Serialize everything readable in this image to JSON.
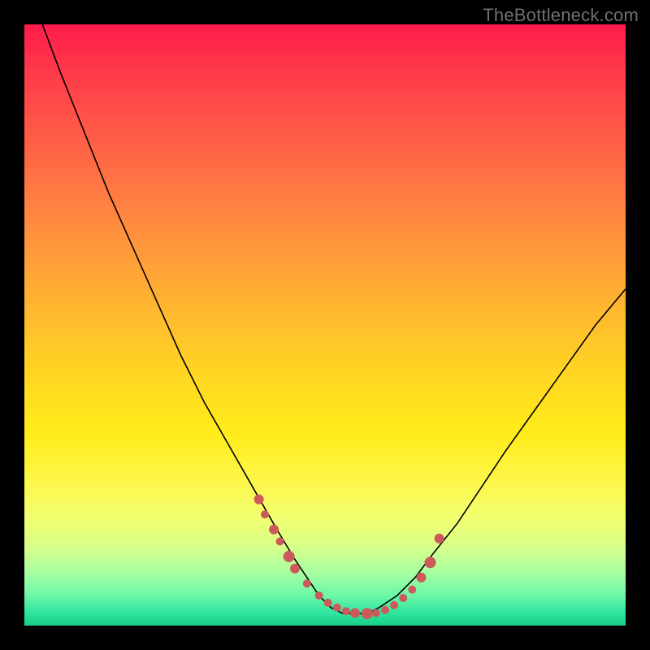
{
  "watermark": "TheBottleneck.com",
  "colors": {
    "frame": "#000000",
    "curve": "#000000",
    "dots": "#cc5a5a"
  },
  "chart_data": {
    "type": "line",
    "title": "",
    "xlabel": "",
    "ylabel": "",
    "xlim": [
      0,
      100
    ],
    "ylim": [
      0,
      100
    ],
    "grid": false,
    "legend": false,
    "series": [
      {
        "name": "curve",
        "x": [
          3,
          6,
          10,
          14,
          18,
          22,
          26,
          30,
          34,
          38,
          42,
          45,
          47,
          49,
          51,
          53,
          55,
          57,
          59,
          62,
          65,
          68,
          72,
          76,
          80,
          85,
          90,
          95,
          100
        ],
        "y": [
          100,
          92,
          82,
          72,
          63,
          54,
          45,
          37,
          30,
          23,
          16,
          11,
          8,
          5,
          3,
          2,
          2,
          2,
          3,
          5,
          8,
          12,
          17,
          23,
          29,
          36,
          43,
          50,
          56
        ]
      }
    ],
    "marker_points": {
      "name": "dots",
      "x": [
        39,
        40,
        41.5,
        42.5,
        44,
        45,
        47,
        49,
        50.5,
        52,
        53.5,
        55,
        57,
        58.5,
        60,
        61.5,
        63,
        64.5,
        66,
        67.5,
        69
      ],
      "y": [
        21,
        18.5,
        16,
        14,
        11.5,
        9.5,
        7,
        5,
        3.8,
        3,
        2.4,
        2.1,
        2,
        2.1,
        2.6,
        3.4,
        4.6,
        6,
        8,
        10.5,
        14.5
      ],
      "r": [
        6,
        5,
        6,
        5,
        7,
        6,
        5,
        5,
        5,
        5,
        5,
        6,
        7,
        5,
        5,
        5,
        5,
        5,
        6,
        7,
        6
      ]
    }
  }
}
